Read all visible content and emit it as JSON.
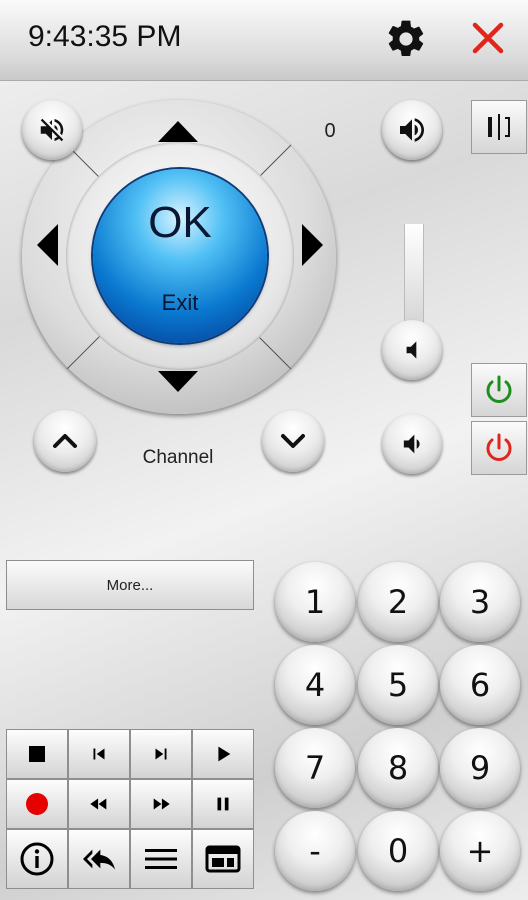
{
  "status": {
    "time": "9:43:35 PM"
  },
  "toolbar": {
    "settings_icon": "gear-icon",
    "close_icon": "close-icon",
    "close_color": "#e0261c"
  },
  "dpad": {
    "ok_label": "OK",
    "exit_label": "Exit"
  },
  "channel": {
    "label": "Channel"
  },
  "volume": {
    "value": "0"
  },
  "more": {
    "label": "More..."
  },
  "power": {
    "on_color": "#1e8f1e",
    "off_color": "#e0261c"
  },
  "record": {
    "color": "#e60000"
  },
  "keypad": {
    "keys": [
      "1",
      "2",
      "3",
      "4",
      "5",
      "6",
      "7",
      "8",
      "9",
      "-",
      "0",
      "+"
    ]
  }
}
